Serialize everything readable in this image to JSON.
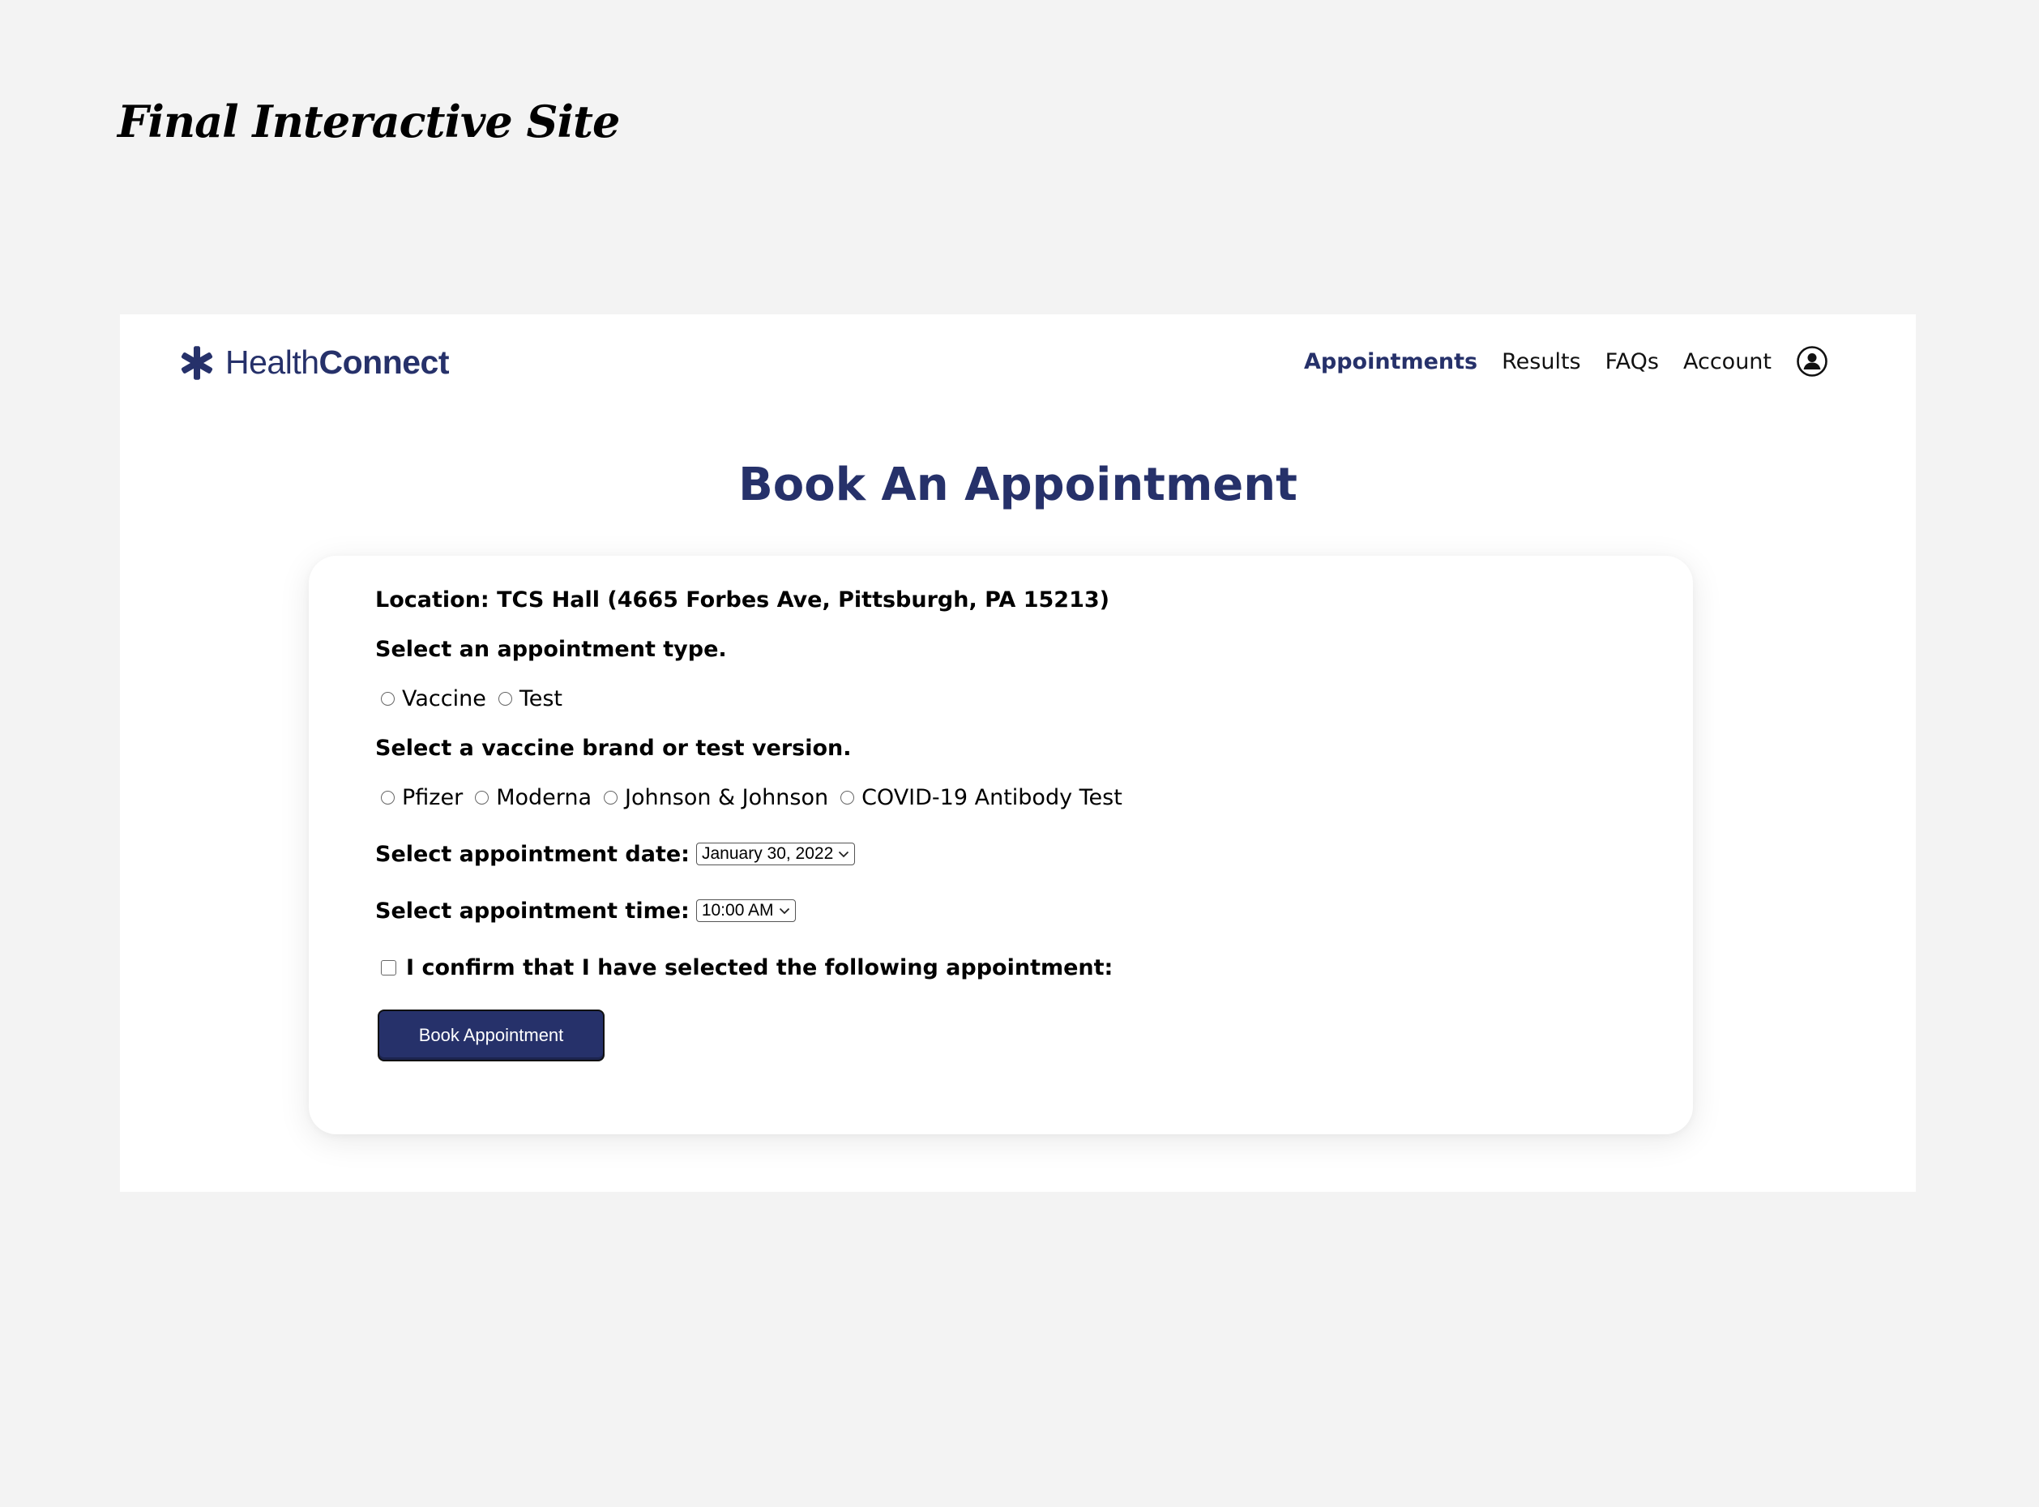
{
  "section_heading": "Final Interactive Site",
  "brand": {
    "name_light": "Health",
    "name_bold": "Connect",
    "icon": "asterisk-icon",
    "color": "#26316a"
  },
  "nav": {
    "items": [
      {
        "label": "Appointments",
        "active": true
      },
      {
        "label": "Results",
        "active": false
      },
      {
        "label": "FAQs",
        "active": false
      },
      {
        "label": "Account",
        "active": false
      }
    ],
    "account_icon": "user-circle-icon"
  },
  "page_title": "Book An Appointment",
  "form": {
    "location": "Location: TCS Hall (4665 Forbes Ave, Pittsburgh, PA 15213)",
    "type_prompt": "Select an appointment type.",
    "type_options": [
      "Vaccine",
      "Test"
    ],
    "brand_prompt": "Select a vaccine brand or test version.",
    "brand_options": [
      "Pfizer",
      "Moderna",
      "Johnson & Johnson",
      "COVID-19 Antibody Test"
    ],
    "date_label": "Select appointment date:",
    "date_value": "January 30, 2022",
    "time_label": "Select appointment time:",
    "time_value": "10:00 AM",
    "confirm_label": "I confirm that I have selected the following appointment:",
    "confirm_checked": false,
    "submit_label": "Book Appointment"
  },
  "colors": {
    "accent": "#26316a",
    "page_background": "#f3f3f3",
    "site_background": "#ffffff"
  }
}
